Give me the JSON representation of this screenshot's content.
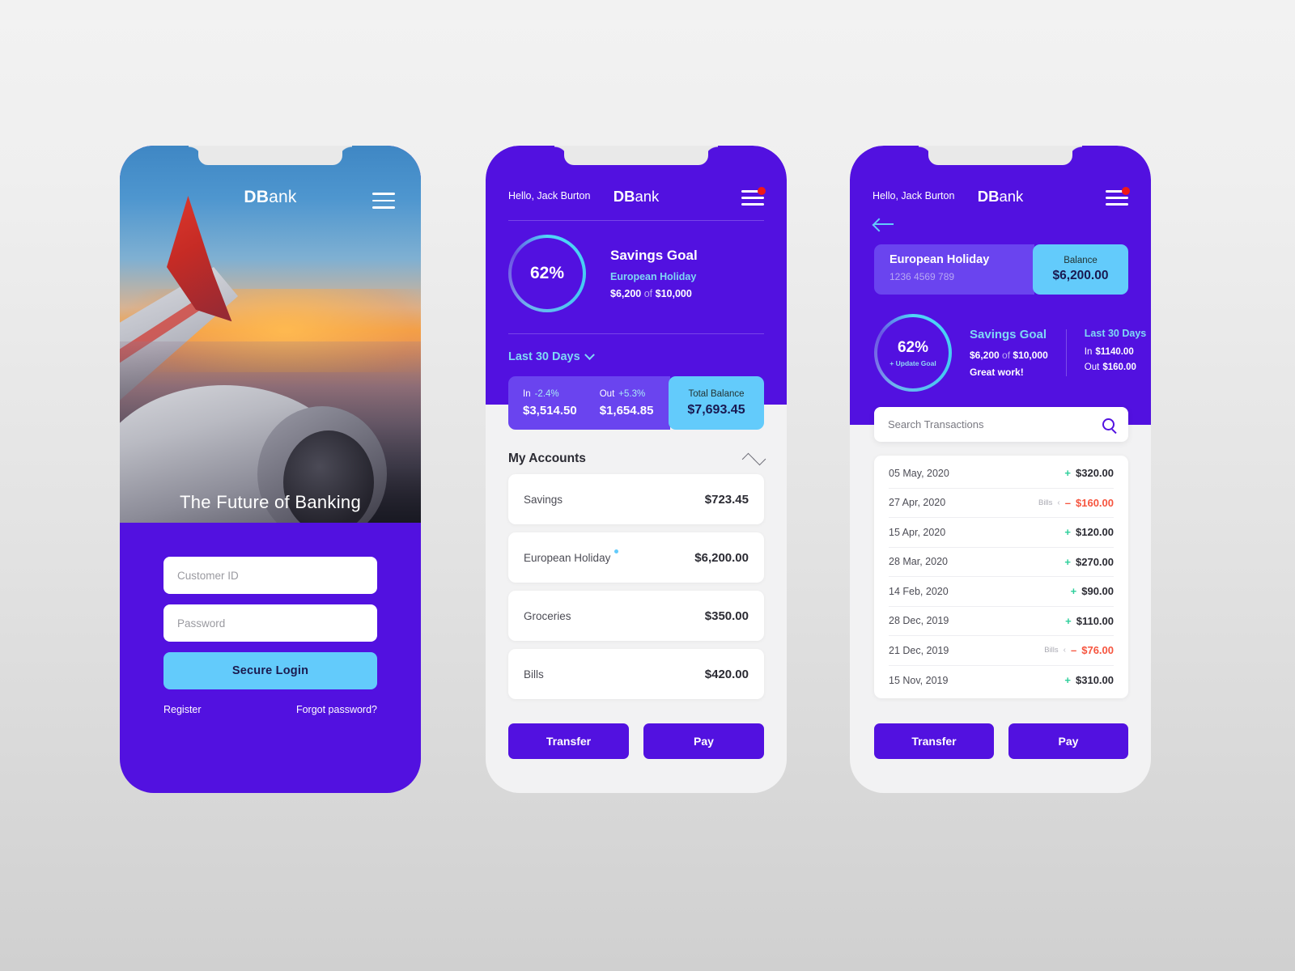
{
  "brand": {
    "bold": "DB",
    "light": "ank"
  },
  "colors": {
    "purple": "#5211e0",
    "purple_light": "#6a44ef",
    "cyan": "#63cbfb",
    "cyan_text": "#7fd8f5",
    "green": "#2ecf9b",
    "red": "#f6553f",
    "notify_dot": "#f01818"
  },
  "login_screen": {
    "hero_title": "The Future of Banking",
    "customer_id_placeholder": "Customer ID",
    "password_placeholder": "Password",
    "customer_id_value": "",
    "password_value": "",
    "login_button": "Secure Login",
    "register_link": "Register",
    "forgot_link": "Forgot password?"
  },
  "dashboard": {
    "greeting": "Hello, Jack Burton",
    "savings_goal": {
      "percent": "62%",
      "title": "Savings Goal",
      "name": "European Holiday",
      "current": "$6,200",
      "of": "of",
      "target": "$10,000"
    },
    "period_label": "Last 30 Days",
    "balance_bar": {
      "in_label": "In",
      "in_change": "-2.4%",
      "in_amount": "$3,514.50",
      "out_label": "Out",
      "out_change": "+5.3%",
      "out_amount": "$1,654.85",
      "total_label": "Total Balance",
      "total_amount": "$7,693.45"
    },
    "accounts_title": "My Accounts",
    "accounts": [
      {
        "name": "Savings",
        "amount": "$723.45",
        "badge": false
      },
      {
        "name": "European Holiday",
        "amount": "$6,200.00",
        "badge": true
      },
      {
        "name": "Groceries",
        "amount": "$350.00",
        "badge": false
      },
      {
        "name": "Bills",
        "amount": "$420.00",
        "badge": false
      }
    ],
    "transfer_button": "Transfer",
    "pay_button": "Pay"
  },
  "account_detail": {
    "greeting": "Hello, Jack Burton",
    "card": {
      "name": "European Holiday",
      "number": "1236 4569 789",
      "balance_label": "Balance",
      "balance_amount": "$6,200.00"
    },
    "goal": {
      "percent": "62%",
      "update_link": "+ Update Goal",
      "title": "Savings Goal",
      "current": "$6,200",
      "of": "of",
      "target": "$10,000",
      "message": "Great work!"
    },
    "period": {
      "label": "Last 30 Days",
      "in_label": "In",
      "in_amount": "$1140.00",
      "out_label": "Out",
      "out_amount": "$160.00"
    },
    "search_placeholder": "Search Transactions",
    "search_value": "",
    "transactions": [
      {
        "date": "05 May, 2020",
        "category": "",
        "sign": "+",
        "amount": "$320.00",
        "type": "pos"
      },
      {
        "date": "27 Apr, 2020",
        "category": "Bills",
        "sign": "–",
        "amount": "$160.00",
        "type": "neg"
      },
      {
        "date": "15 Apr, 2020",
        "category": "",
        "sign": "+",
        "amount": "$120.00",
        "type": "pos"
      },
      {
        "date": "28 Mar, 2020",
        "category": "",
        "sign": "+",
        "amount": "$270.00",
        "type": "pos"
      },
      {
        "date": "14 Feb, 2020",
        "category": "",
        "sign": "+",
        "amount": "$90.00",
        "type": "pos"
      },
      {
        "date": "28 Dec, 2019",
        "category": "",
        "sign": "+",
        "amount": "$110.00",
        "type": "pos"
      },
      {
        "date": "21 Dec, 2019",
        "category": "Bills",
        "sign": "–",
        "amount": "$76.00",
        "type": "neg"
      },
      {
        "date": "15 Nov, 2019",
        "category": "",
        "sign": "+",
        "amount": "$310.00",
        "type": "pos"
      }
    ],
    "transfer_button": "Transfer",
    "pay_button": "Pay"
  }
}
